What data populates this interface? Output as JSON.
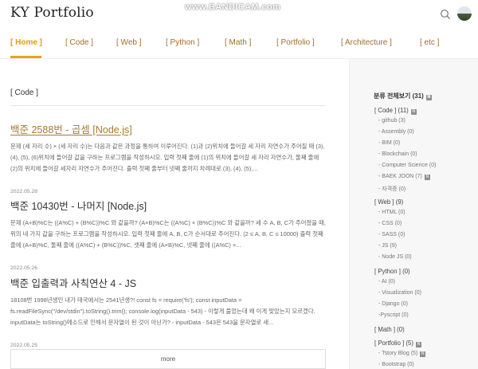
{
  "header": {
    "site_title": "KY Portfolio",
    "watermark": "www.BANDICAM.com"
  },
  "nav": {
    "items": [
      {
        "label": "[ Home ]",
        "active": true
      },
      {
        "label": "[ Code ]"
      },
      {
        "label": "[ Web ]"
      },
      {
        "label": "[ Python ]"
      },
      {
        "label": "[ Math ]"
      },
      {
        "label": "[ Portfolio ]"
      },
      {
        "label": "[ Architecture ]"
      },
      {
        "label": "[ etc ]"
      }
    ]
  },
  "main": {
    "section_title": "[ Code ]",
    "posts": [
      {
        "title": "백준 2588번 - 곱셈 [Node.js]",
        "excerpt": "문제 (세 자리 수) × (세 자리 수)는 다음과 같은 과정을 통하여 이루어진다. (1)과 (2)위치에 들어갈 세 자리 자연수가 주어질 때 (3), (4), (5), (6)위치에 들어갈 값을 구하는 프로그램을 작성하시오. 입력 첫째 줄에 (1)의 위치에 들어갈 세 자리 자연수가, 둘째 줄에 (2)의 위치에 들어갈 세자리 자연수가 주어진다. 출력 첫째 줄부터 넷째 줄까지 차례대로 (3), (4), (5),...",
        "date": "2022.05.28"
      },
      {
        "title": "백준 10430번 - 나머지 [Node.js]",
        "excerpt": "문제 (A+B)%C는 ((A%C) + (B%C))%C 와 같을까? (A×B)%C는 ((A%C) × (B%C))%C 와 같을까? 세 수 A, B, C가 주어졌을 때, 위의 네 가지 값을 구하는 프로그램을 작성하시오. 입력 첫째 줄에 A, B, C가 순서대로 주어진다. (2 ≤ A, B, C ≤ 10000) 출력 첫째 줄에 (A+B)%C, 둘째 줄에 ((A%C) + (B%C))%C, 셋째 줄에 (A×B)%C, 넷째 줄에 ((A%C) ×...",
        "date": "2022.05.26"
      },
      {
        "title": "백준 입출력과 사칙연산 4 - JS",
        "excerpt": "18108번 1998년생인 내가 태국에서는 2541년생?! const fs = require('fs'); const inputData = fs.readFileSync(\"/dev/stdin\").toString().trim(); console.log(inputData - 543) - 이렇게 풀었는데 왜 이게 맞았는지 모르겠다. inputData는 toString()메소드로 인해서 문자열이 된 것이 아닌가? - inputData - 543은 543을 문자열로 새...",
        "date": "2022.05.25"
      }
    ],
    "more_label": "more"
  },
  "sidebar": {
    "title": "분류 전체보기 (31)",
    "rows": [
      {
        "kind": "cat",
        "label": "[ Code ] (11)",
        "badge": true
      },
      {
        "kind": "sub",
        "label": "- github (3)"
      },
      {
        "kind": "sub",
        "label": "- Assembly (0)"
      },
      {
        "kind": "sub",
        "label": "- BIM (0)"
      },
      {
        "kind": "sub",
        "label": "- Blockchain (0)"
      },
      {
        "kind": "sub",
        "label": "- Computer Science (0)"
      },
      {
        "kind": "sub",
        "label": "- BAEK JOON (7)",
        "badge": true
      },
      {
        "kind": "sub",
        "label": "- 자격증 (0)"
      },
      {
        "kind": "cat",
        "label": "[ Web ] (9)"
      },
      {
        "kind": "sub",
        "label": "- HTML (0)"
      },
      {
        "kind": "sub",
        "label": "- CSS (0)"
      },
      {
        "kind": "sub",
        "label": "- SASS (0)"
      },
      {
        "kind": "sub",
        "label": "- JS (9)"
      },
      {
        "kind": "sub",
        "label": "- Node JS (0)"
      },
      {
        "kind": "cat",
        "label": "[ Python ] (0)"
      },
      {
        "kind": "sub",
        "label": "- AI (0)"
      },
      {
        "kind": "sub",
        "label": "- Visualization (0)"
      },
      {
        "kind": "sub",
        "label": "- Django (0)"
      },
      {
        "kind": "sub",
        "label": "-Pyscript (0)"
      },
      {
        "kind": "cat",
        "label": "[ Math ] (0)"
      },
      {
        "kind": "cat",
        "label": "[ Portfolio ] (5)",
        "badge": true
      },
      {
        "kind": "sub",
        "label": "- Tstory Blog (5)",
        "badge": true
      },
      {
        "kind": "sub",
        "label": "- Bootstrap (0)"
      }
    ],
    "badge_symbol": "N"
  },
  "icons": {
    "search": "search-icon",
    "avatar": "avatar"
  },
  "colors": {
    "accent": "#e79b12",
    "nav_text": "#a46c2c",
    "link_highlight": "#a67a35"
  }
}
